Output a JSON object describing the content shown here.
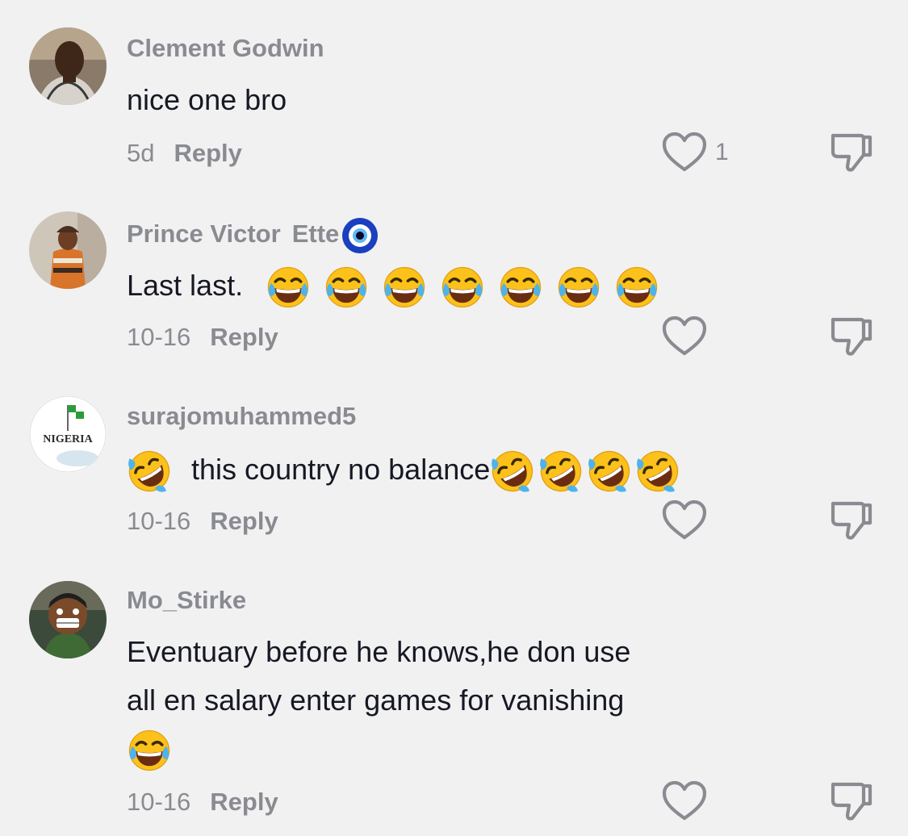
{
  "colors": {
    "background": "#f1f1f2",
    "text_primary": "#161823",
    "text_secondary": "#8a8b91"
  },
  "comments": [
    {
      "username": "Clement Godwin",
      "text": "nice one bro",
      "time": "5d",
      "reply_label": "Reply",
      "like_count": "1",
      "avatar": "user-photo"
    },
    {
      "username": "Prince Victor",
      "username_suffix": "Ette",
      "username_icon": "nazar-amulet-emoji",
      "text": "Last last.",
      "emojis": [
        "face-with-tears-of-joy-emoji",
        "face-with-tears-of-joy-emoji",
        "face-with-tears-of-joy-emoji",
        "face-with-tears-of-joy-emoji",
        "face-with-tears-of-joy-emoji",
        "face-with-tears-of-joy-emoji",
        "face-with-tears-of-joy-emoji"
      ],
      "time": "10-16",
      "reply_label": "Reply",
      "avatar": "user-photo"
    },
    {
      "username": "surajomuhammed5",
      "text": "this country no balance",
      "emoji_lead": "rolling-on-floor-laughing-emoji",
      "emojis": [
        "rolling-on-floor-laughing-emoji",
        "rolling-on-floor-laughing-emoji",
        "rolling-on-floor-laughing-emoji",
        "rolling-on-floor-laughing-emoji"
      ],
      "time": "10-16",
      "reply_label": "Reply",
      "avatar_text": "NIGERIA"
    },
    {
      "username": "Mo_Stirke",
      "text_line1": "Eventuary before he knows,he don use",
      "text_line2": "all en salary enter games for vanishing",
      "emojis": [
        "face-with-tears-of-joy-emoji"
      ],
      "time": "10-16",
      "reply_label": "Reply",
      "avatar": "cartoon-character"
    }
  ]
}
